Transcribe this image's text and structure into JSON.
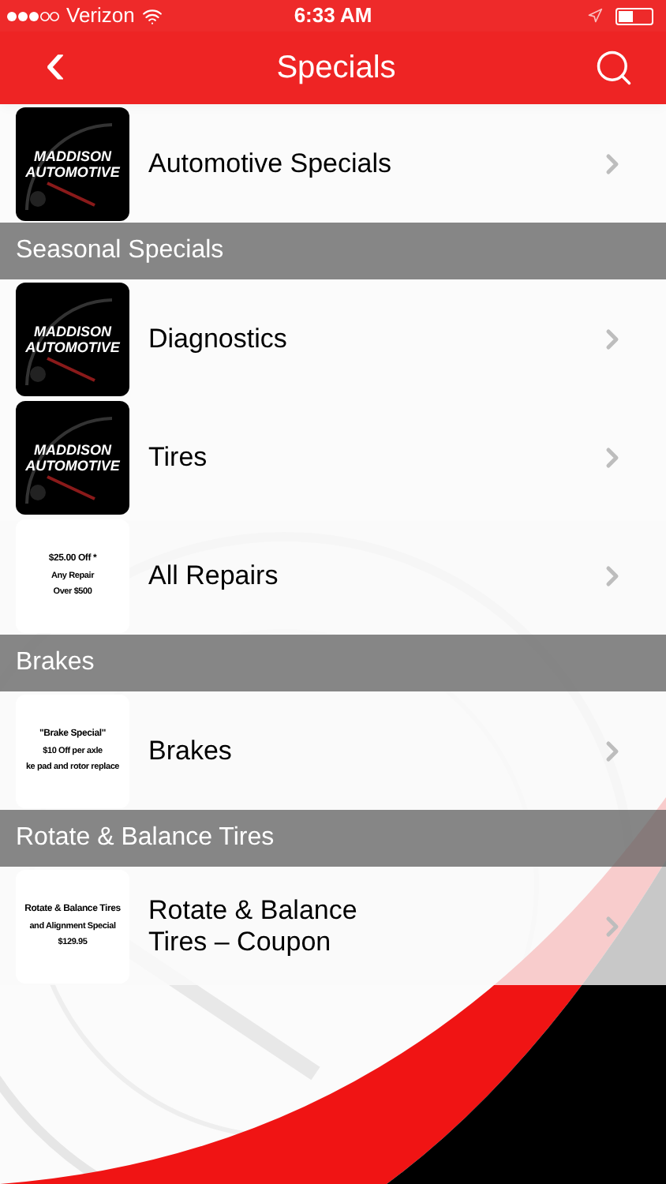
{
  "status_bar": {
    "carrier": "Verizon",
    "time": "6:33 AM"
  },
  "nav_bar": {
    "back": "‹",
    "title": "Specials"
  },
  "sections": [
    {
      "items": [
        {
          "label": "Automotive Specials",
          "thumb": {
            "kind": "logo",
            "lines": [
              "MADDISON",
              "AUTOMOTIVE"
            ]
          }
        }
      ]
    },
    {
      "header": "Seasonal Specials",
      "items": [
        {
          "label": "Diagnostics",
          "thumb": {
            "kind": "logo",
            "lines": [
              "MADDISON",
              "AUTOMOTIVE"
            ]
          }
        },
        {
          "label": "Tires",
          "thumb": {
            "kind": "logo",
            "lines": [
              "MADDISON",
              "AUTOMOTIVE"
            ]
          }
        },
        {
          "label": "All Repairs",
          "thumb": {
            "kind": "coupon",
            "lines": [
              "$25.00 Off *",
              "Any Repair",
              "Over $500"
            ]
          }
        }
      ]
    },
    {
      "header": "Brakes",
      "items": [
        {
          "label": "Brakes",
          "thumb": {
            "kind": "coupon",
            "lines": [
              "\"Brake Special\"",
              "$10 Off per axle",
              "ke pad and rotor replace"
            ]
          }
        }
      ]
    },
    {
      "header": "Rotate & Balance Tires",
      "items": [
        {
          "label": "Rotate & Balance Tires – Coupon",
          "thumb": {
            "kind": "coupon",
            "lines": [
              "Rotate & Balance Tires",
              "and Alignment Special",
              "$129.95"
            ]
          }
        }
      ]
    }
  ]
}
